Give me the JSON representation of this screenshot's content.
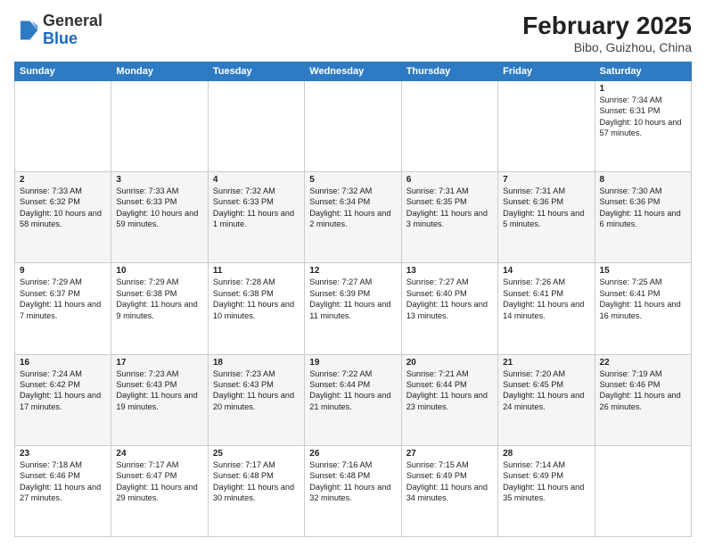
{
  "header": {
    "logo_general": "General",
    "logo_blue": "Blue",
    "month_year": "February 2025",
    "location": "Bibo, Guizhou, China"
  },
  "days_of_week": [
    "Sunday",
    "Monday",
    "Tuesday",
    "Wednesday",
    "Thursday",
    "Friday",
    "Saturday"
  ],
  "weeks": [
    [
      {
        "day": "",
        "content": ""
      },
      {
        "day": "",
        "content": ""
      },
      {
        "day": "",
        "content": ""
      },
      {
        "day": "",
        "content": ""
      },
      {
        "day": "",
        "content": ""
      },
      {
        "day": "",
        "content": ""
      },
      {
        "day": "1",
        "content": "Sunrise: 7:34 AM\nSunset: 6:31 PM\nDaylight: 10 hours and 57 minutes."
      }
    ],
    [
      {
        "day": "2",
        "content": "Sunrise: 7:33 AM\nSunset: 6:32 PM\nDaylight: 10 hours and 58 minutes."
      },
      {
        "day": "3",
        "content": "Sunrise: 7:33 AM\nSunset: 6:33 PM\nDaylight: 10 hours and 59 minutes."
      },
      {
        "day": "4",
        "content": "Sunrise: 7:32 AM\nSunset: 6:33 PM\nDaylight: 11 hours and 1 minute."
      },
      {
        "day": "5",
        "content": "Sunrise: 7:32 AM\nSunset: 6:34 PM\nDaylight: 11 hours and 2 minutes."
      },
      {
        "day": "6",
        "content": "Sunrise: 7:31 AM\nSunset: 6:35 PM\nDaylight: 11 hours and 3 minutes."
      },
      {
        "day": "7",
        "content": "Sunrise: 7:31 AM\nSunset: 6:36 PM\nDaylight: 11 hours and 5 minutes."
      },
      {
        "day": "8",
        "content": "Sunrise: 7:30 AM\nSunset: 6:36 PM\nDaylight: 11 hours and 6 minutes."
      }
    ],
    [
      {
        "day": "9",
        "content": "Sunrise: 7:29 AM\nSunset: 6:37 PM\nDaylight: 11 hours and 7 minutes."
      },
      {
        "day": "10",
        "content": "Sunrise: 7:29 AM\nSunset: 6:38 PM\nDaylight: 11 hours and 9 minutes."
      },
      {
        "day": "11",
        "content": "Sunrise: 7:28 AM\nSunset: 6:38 PM\nDaylight: 11 hours and 10 minutes."
      },
      {
        "day": "12",
        "content": "Sunrise: 7:27 AM\nSunset: 6:39 PM\nDaylight: 11 hours and 11 minutes."
      },
      {
        "day": "13",
        "content": "Sunrise: 7:27 AM\nSunset: 6:40 PM\nDaylight: 11 hours and 13 minutes."
      },
      {
        "day": "14",
        "content": "Sunrise: 7:26 AM\nSunset: 6:41 PM\nDaylight: 11 hours and 14 minutes."
      },
      {
        "day": "15",
        "content": "Sunrise: 7:25 AM\nSunset: 6:41 PM\nDaylight: 11 hours and 16 minutes."
      }
    ],
    [
      {
        "day": "16",
        "content": "Sunrise: 7:24 AM\nSunset: 6:42 PM\nDaylight: 11 hours and 17 minutes."
      },
      {
        "day": "17",
        "content": "Sunrise: 7:23 AM\nSunset: 6:43 PM\nDaylight: 11 hours and 19 minutes."
      },
      {
        "day": "18",
        "content": "Sunrise: 7:23 AM\nSunset: 6:43 PM\nDaylight: 11 hours and 20 minutes."
      },
      {
        "day": "19",
        "content": "Sunrise: 7:22 AM\nSunset: 6:44 PM\nDaylight: 11 hours and 21 minutes."
      },
      {
        "day": "20",
        "content": "Sunrise: 7:21 AM\nSunset: 6:44 PM\nDaylight: 11 hours and 23 minutes."
      },
      {
        "day": "21",
        "content": "Sunrise: 7:20 AM\nSunset: 6:45 PM\nDaylight: 11 hours and 24 minutes."
      },
      {
        "day": "22",
        "content": "Sunrise: 7:19 AM\nSunset: 6:46 PM\nDaylight: 11 hours and 26 minutes."
      }
    ],
    [
      {
        "day": "23",
        "content": "Sunrise: 7:18 AM\nSunset: 6:46 PM\nDaylight: 11 hours and 27 minutes."
      },
      {
        "day": "24",
        "content": "Sunrise: 7:17 AM\nSunset: 6:47 PM\nDaylight: 11 hours and 29 minutes."
      },
      {
        "day": "25",
        "content": "Sunrise: 7:17 AM\nSunset: 6:48 PM\nDaylight: 11 hours and 30 minutes."
      },
      {
        "day": "26",
        "content": "Sunrise: 7:16 AM\nSunset: 6:48 PM\nDaylight: 11 hours and 32 minutes."
      },
      {
        "day": "27",
        "content": "Sunrise: 7:15 AM\nSunset: 6:49 PM\nDaylight: 11 hours and 34 minutes."
      },
      {
        "day": "28",
        "content": "Sunrise: 7:14 AM\nSunset: 6:49 PM\nDaylight: 11 hours and 35 minutes."
      },
      {
        "day": "",
        "content": ""
      }
    ]
  ]
}
